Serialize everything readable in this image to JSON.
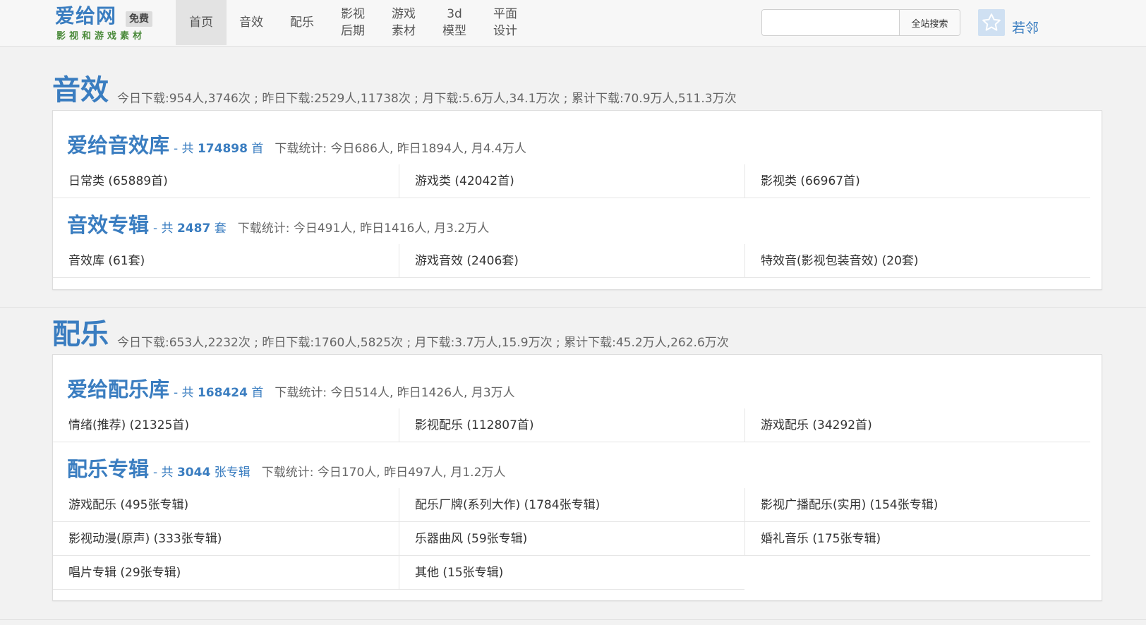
{
  "site": {
    "logo_main": "爱给网",
    "logo_badge": "免费",
    "logo_sub": "影视和游戏素材"
  },
  "nav": {
    "items": [
      {
        "label": "首页",
        "active": true
      },
      {
        "label": "音效",
        "active": false
      },
      {
        "label": "配乐",
        "active": false
      },
      {
        "label": "影视\n后期",
        "active": false
      },
      {
        "label": "游戏\n素材",
        "active": false
      },
      {
        "label": "3d\n模型",
        "active": false
      },
      {
        "label": "平面\n设计",
        "active": false
      }
    ]
  },
  "search": {
    "value": "",
    "button_label": "全站搜索"
  },
  "user": {
    "name": "若邻"
  },
  "sections": [
    {
      "title": "音效",
      "stats": "今日下载:954人,3746次 ; 昨日下载:2529人,11738次 ; 月下载:5.6万人,34.1万次 ; 累计下载:70.9万人,511.3万次",
      "libraries": [
        {
          "name": "爱给音效库",
          "count_prefix": "- 共 ",
          "count": "174898",
          "count_unit": " 首",
          "download_stats": "下载统计: 今日686人, 昨日1894人, 月4.4万人",
          "items": [
            "日常类 (65889首)",
            "游戏类 (42042首)",
            "影视类 (66967首)"
          ]
        },
        {
          "name": "音效专辑",
          "count_prefix": "- 共 ",
          "count": "2487",
          "count_unit": " 套",
          "download_stats": "下载统计: 今日491人, 昨日1416人, 月3.2万人",
          "items": [
            "音效库 (61套)",
            "游戏音效 (2406套)",
            "特效音(影视包装音效) (20套)"
          ]
        }
      ]
    },
    {
      "title": "配乐",
      "stats": "今日下载:653人,2232次 ; 昨日下载:1760人,5825次 ; 月下载:3.7万人,15.9万次 ; 累计下载:45.2万人,262.6万次",
      "libraries": [
        {
          "name": "爱给配乐库",
          "count_prefix": "- 共 ",
          "count": "168424",
          "count_unit": " 首",
          "download_stats": "下载统计: 今日514人, 昨日1426人, 月3万人",
          "items": [
            "情绪(推荐) (21325首)",
            "影视配乐 (112807首)",
            "游戏配乐 (34292首)"
          ]
        },
        {
          "name": "配乐专辑",
          "count_prefix": "- 共 ",
          "count": "3044",
          "count_unit": " 张专辑",
          "download_stats": "下载统计: 今日170人, 昨日497人, 月1.2万人",
          "items": [
            "游戏配乐 (495张专辑)",
            "配乐厂牌(系列大作) (1784张专辑)",
            "影视广播配乐(实用) (154张专辑)",
            "影视动漫(原声) (333张专辑)",
            "乐器曲风 (59张专辑)",
            "婚礼音乐 (175张专辑)",
            "唱片专辑 (29张专辑)",
            "其他 (15张专辑)"
          ]
        }
      ]
    }
  ]
}
